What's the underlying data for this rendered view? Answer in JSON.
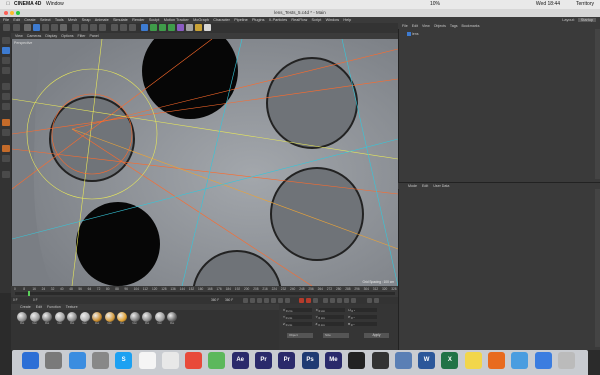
{
  "menubar": {
    "appname": "CINEMA 4D",
    "menu": "Window",
    "battery": "10%",
    "time": "Wed 18:44",
    "user": "Territory"
  },
  "window": {
    "title": "lens_Tests_5.c4d * - Main"
  },
  "c4d_menu": [
    "File",
    "Edit",
    "Create",
    "Select",
    "Tools",
    "Mesh",
    "Snap",
    "Animate",
    "Simulate",
    "Render",
    "Sculpt",
    "Motion Tracker",
    "MoGraph",
    "Character",
    "Pipeline",
    "Plugins",
    "X-Particles",
    "RealFlow",
    "Script",
    "Window",
    "Help"
  ],
  "layout": {
    "label": "Layout:",
    "value": "Startup"
  },
  "viewport": {
    "menu": [
      "View",
      "Cameras",
      "Display",
      "Options",
      "Filter",
      "Panel"
    ],
    "label": "Perspective",
    "grid": "Grid Spacing : 100 cm"
  },
  "timeline": {
    "ticks": [
      "0",
      "8",
      "16",
      "24",
      "32",
      "40",
      "48",
      "56",
      "64",
      "72",
      "80",
      "88",
      "96",
      "104",
      "112",
      "120",
      "128",
      "136",
      "144",
      "152",
      "160",
      "168",
      "176",
      "184",
      "192",
      "200",
      "208",
      "216",
      "224",
      "232",
      "240",
      "248",
      "256",
      "264",
      "272",
      "280",
      "288",
      "296",
      "304",
      "312",
      "320",
      "328"
    ],
    "start": "0 F",
    "current": "0 F",
    "end": "360 F",
    "end2": "360 F",
    "frame": "0 F"
  },
  "materials": {
    "menu": [
      "Create",
      "Edit",
      "Function",
      "Texture"
    ],
    "items": [
      "Mat",
      "Mat",
      "Mat",
      "Mat",
      "Mat",
      "Mat",
      "Mat",
      "Mat",
      "Mat",
      "Mat",
      "Mat",
      "Mat",
      "Mat"
    ]
  },
  "coords": {
    "rows": [
      {
        "a": "X",
        "av": "0 cm",
        "b": "X",
        "bv": "0 cm",
        "c": "H",
        "cv": "0 °"
      },
      {
        "a": "Y",
        "av": "0 cm",
        "b": "Y",
        "bv": "0 cm",
        "c": "P",
        "cv": "0 °"
      },
      {
        "a": "Z",
        "av": "0 cm",
        "b": "Z",
        "bv": "0 cm",
        "c": "B",
        "cv": "0 °"
      }
    ],
    "mode1": "Object",
    "mode2": "Size",
    "apply": "Apply"
  },
  "object_manager": {
    "menu": [
      "File",
      "Edit",
      "View",
      "Objects",
      "Tags",
      "Bookmarks"
    ],
    "object": "lens"
  },
  "attributes": {
    "menu": [
      "Mode",
      "Edit",
      "User Data"
    ]
  },
  "dock": {
    "items": [
      "Finder",
      "Launchpad",
      "Safari",
      "System Prefs",
      "Skype",
      "Calendar",
      "Photos",
      "Chrome",
      "Maps",
      "After Effects",
      "Premiere",
      "Premiere Pro",
      "Photoshop",
      "Media Encoder",
      "Cinema 4D",
      "Cinema",
      "Preview",
      "Word",
      "Excel",
      "Notes",
      "Firefox",
      "Downloads",
      "Applications",
      "Trash"
    ]
  },
  "colors": {
    "viewport": "#8f9398",
    "accent": "#e8a33a"
  }
}
